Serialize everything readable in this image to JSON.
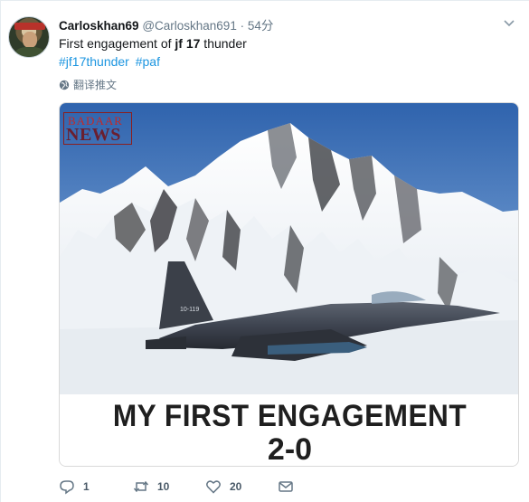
{
  "tweet": {
    "display_name": "Carloskhan69",
    "handle": "@Carloskhan691",
    "dot": "·",
    "time": "54分",
    "text_prefix": "First engagement of ",
    "text_bold": "jf 17",
    "text_suffix": " thunder",
    "hashtags": [
      "#jf17thunder",
      "#paf"
    ],
    "translate_label": "翻译推文"
  },
  "media": {
    "logo_line1": "BADAAR",
    "logo_line2": "NEWS",
    "aircraft_marking": "10-119",
    "caption_line1": "MY FIRST ENGAGEMENT",
    "caption_line2": "2-0"
  },
  "actions": {
    "reply_count": "1",
    "retweet_count": "10",
    "like_count": "20"
  },
  "icons": {
    "caret": "chevron-down-icon",
    "globe": "globe-icon",
    "reply": "reply-icon",
    "retweet": "retweet-icon",
    "like": "heart-icon",
    "message": "envelope-icon"
  },
  "colors": {
    "link": "#1b95e0",
    "muted": "#657786",
    "sky": "#3b6fb5"
  }
}
